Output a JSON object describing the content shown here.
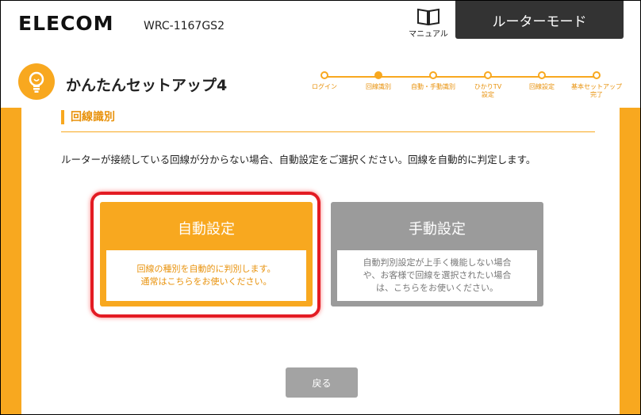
{
  "header": {
    "brand": "ELECOM",
    "model": "WRC-1167GS2",
    "manual_label": "マニュアル",
    "mode": "ルーターモード"
  },
  "setup": {
    "title": "かんたんセットアップ4",
    "steps": [
      {
        "label": "ログイン",
        "active": false
      },
      {
        "label": "回線識別",
        "active": true
      },
      {
        "label": "自動・手動識別",
        "active": false
      },
      {
        "label": "ひかりTV\n設定",
        "active": false
      },
      {
        "label": "回線設定",
        "active": false
      },
      {
        "label": "基本セットアップ\n完了",
        "active": false
      }
    ]
  },
  "section": {
    "heading": "回線識別",
    "instruction": "ルーターが接続している回線が分からない場合、自動設定をご選択ください。回線を自動的に判定します。"
  },
  "options": {
    "auto": {
      "title": "自動設定",
      "desc": "回線の種別を自動的に判別します。\n通常はこちらをお使いください。"
    },
    "manual": {
      "title": "手動設定",
      "desc": "自動判別設定が上手く機能しない場合\nや、お客様で回線を選択されたい場合\nは、こちらをお使いください。"
    }
  },
  "footer": {
    "back_label": "戻る"
  },
  "colors": {
    "accent": "#f8a81f",
    "highlight": "#e31b23",
    "mode_tab": "#333333",
    "disabled": "#9b9b9b"
  }
}
